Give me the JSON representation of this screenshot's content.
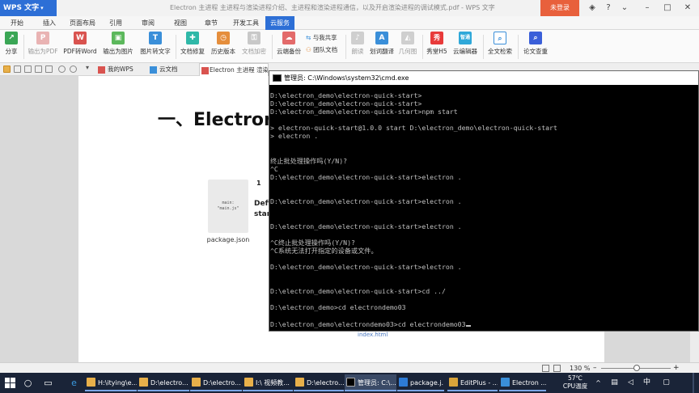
{
  "app": {
    "logo": "WPS 文字",
    "document_title": "Electron 主进程  主进程与渲染进程介绍、主进程和渲染进程通信，以及开启渲染进程的调试模式.pdf - WPS 文字",
    "login_label": "未登录"
  },
  "menu": {
    "tabs": [
      {
        "label": "开始"
      },
      {
        "label": "插入"
      },
      {
        "label": "页面布局"
      },
      {
        "label": "引用"
      },
      {
        "label": "审阅"
      },
      {
        "label": "视图"
      },
      {
        "label": "章节"
      },
      {
        "label": "开发工具"
      },
      {
        "label": "云服务"
      }
    ],
    "active_index": 8
  },
  "ribbon": {
    "share": "分享",
    "export_pdf": "输出为PDF",
    "pdf_to_word": "PDF转Word",
    "export_image": "输出为图片",
    "image_to_text": "图片转文字",
    "doc_repair": "文档修复",
    "history": "历史版本",
    "doc_encrypt": "文档加密",
    "cloud_backup": "云端备份",
    "share_with_me": "与我共享",
    "team_docs": "团队文档",
    "read_aloud": "朗读",
    "translate": "划词翻译",
    "geometry": "几何图",
    "xiutang": "秀堂H5",
    "cloud_editor": "云编辑器",
    "full_search": "全文检索",
    "paper_check": "论文查重",
    "xiutang_icon_text": "秀",
    "cloud_editor_icon_text": "智通"
  },
  "doc_tabs": {
    "my_wps": "我的WPS",
    "cloud_docs": "云文档",
    "current": "Electron 主进程 渲染进程介绍 …"
  },
  "document": {
    "heading": "一、Electron",
    "diagram_code": "main:\n\"main.js\"",
    "diagram_label": "package.json",
    "diagram_number": "1",
    "diagram_side_line1": "Defi",
    "diagram_side_line2": "star",
    "bottom_label": "index.html"
  },
  "status": {
    "zoom": "130 %"
  },
  "cmd": {
    "title": "管理员: C:\\Windows\\system32\\cmd.exe",
    "lines": [
      "D:\\electron_demo\\electron-quick-start>",
      "D:\\electron_demo\\electron-quick-start>",
      "D:\\electron_demo\\electron-quick-start>npm start",
      "",
      "> electron-quick-start@1.0.0 start D:\\electron_demo\\electron-quick-start",
      "> electron .",
      "",
      "",
      "终止批处理操作吗(Y/N)?",
      "^C",
      "D:\\electron_demo\\electron-quick-start>electron .",
      "",
      "",
      "D:\\electron_demo\\electron-quick-start>electron .",
      "",
      "",
      "D:\\electron_demo\\electron-quick-start>electron .",
      "",
      "^C终止批处理操作吗(Y/N)?",
      "^C系统无法打开指定的设备或文件。",
      "",
      "D:\\electron_demo\\electron-quick-start>electron .",
      "",
      "",
      "D:\\electron_demo\\electron-quick-start>cd ../",
      "",
      "D:\\electron_demo>cd electrondemo03",
      "",
      "D:\\electron_demo\\electrondemo03>cd electrondemo03"
    ]
  },
  "taskbar": {
    "items": [
      {
        "label": "H:\\itying\\e..."
      },
      {
        "label": "D:\\electro..."
      },
      {
        "label": "D:\\electro..."
      },
      {
        "label": "I:\\ 视频教..."
      },
      {
        "label": "D:\\electro..."
      },
      {
        "label": "管理员: C:\\..."
      },
      {
        "label": "package.j..."
      },
      {
        "label": "EditPlus - ..."
      },
      {
        "label": "Electron ..."
      }
    ],
    "temperature": "57℃",
    "cpu_label": "CPU温度"
  },
  "colors": {
    "accent": "#2d6fd6",
    "login": "#e8603c",
    "taskbar": "#1a2438",
    "cmd_bg": "#000000",
    "cmd_text": "#c0c0c0"
  }
}
